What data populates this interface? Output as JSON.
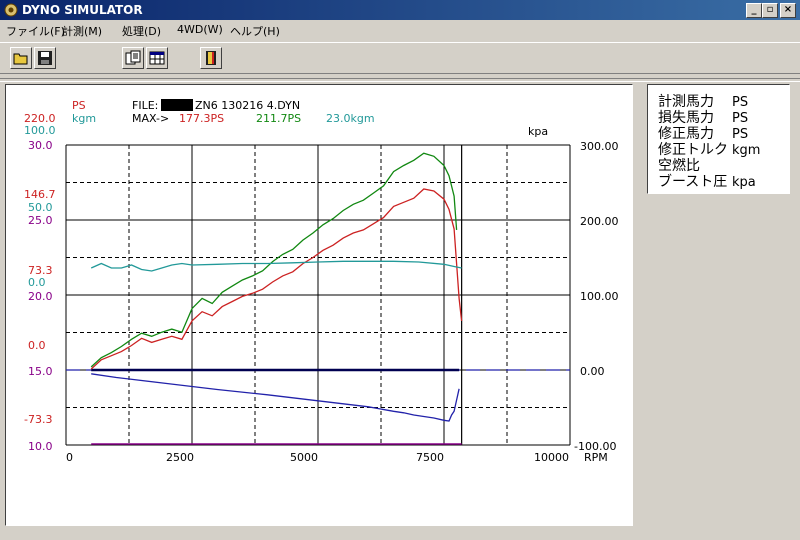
{
  "window": {
    "title": "DYNO SIMULATOR",
    "min_glyph": "_",
    "max_glyph": "▫",
    "close_glyph": "×"
  },
  "menu": [
    {
      "label": "ファイル(F)"
    },
    {
      "label": "計測(M)"
    },
    {
      "label": "処理(D)"
    },
    {
      "label": "4WD(W)"
    },
    {
      "label": "ヘルプ(H)"
    }
  ],
  "toolbar": {
    "buttons": [
      "open-folder-icon",
      "save-disk-icon",
      "process-icon",
      "table-icon",
      "exit-door-icon"
    ]
  },
  "header": {
    "ps_label": "PS",
    "kgm_label": "kgm",
    "file_prefix": "FILE:",
    "file_name": "ZN6  130216  4.DYN",
    "max_label": "MAX->",
    "max_ps": "177.3PS",
    "max_ps2": "211.7PS",
    "max_kgm": "23.0kgm",
    "right_unit": "kpa",
    "x_unit": "RPM"
  },
  "legend": [
    {
      "name": "計測馬力",
      "unit": "PS"
    },
    {
      "name": "損失馬力",
      "unit": "PS"
    },
    {
      "name": "修正馬力",
      "unit": "PS"
    },
    {
      "name": "修正トルク",
      "unit": "kgm"
    },
    {
      "name": "空燃比",
      "unit": ""
    },
    {
      "name": "ブースト圧",
      "unit": "kpa"
    }
  ],
  "colors": {
    "ps": "#cc2222",
    "kgm": "#229999",
    "afr": "#880088",
    "green": "#118811",
    "boost": "#2222aa",
    "dark": "#000000"
  },
  "chart_data": {
    "type": "line",
    "xlabel": "RPM",
    "xlim": [
      0,
      10000
    ],
    "x_ticks": [
      "0",
      "2500",
      "5000",
      "7500",
      "10000"
    ],
    "left_ticks_ps": [
      "220.0",
      "146.7",
      "73.3",
      "0.0",
      "-73.3"
    ],
    "left_ticks_kgm": [
      "100.0",
      "50.0",
      "0.0"
    ],
    "left_ticks_afr": [
      "30.0",
      "25.0",
      "20.0",
      "15.0",
      "10.0"
    ],
    "right_ticks_kpa": [
      "300.00",
      "200.00",
      "100.00",
      "0.00",
      "-100.00"
    ],
    "ylim_ps": [
      -110,
      220
    ],
    "ylim_kpa": [
      -100,
      300
    ],
    "series": [
      {
        "name": "修正馬力",
        "axis": "ps",
        "x": [
          500,
          700,
          900,
          1100,
          1300,
          1500,
          1700,
          1900,
          2100,
          2300,
          2500,
          2700,
          2900,
          3100,
          3300,
          3500,
          3700,
          3900,
          4100,
          4300,
          4500,
          4700,
          4900,
          5100,
          5300,
          5500,
          5700,
          5900,
          6100,
          6300,
          6500,
          6700,
          6900,
          7100,
          7300,
          7500,
          7600,
          7700,
          7800,
          7850
        ],
        "y": [
          1,
          10,
          14,
          18,
          24,
          31,
          27,
          30,
          33,
          30,
          48,
          57,
          53,
          62,
          67,
          72,
          75,
          79,
          86,
          92,
          96,
          104,
          110,
          117,
          122,
          129,
          134,
          137,
          143,
          149,
          160,
          164,
          168,
          177,
          175,
          167,
          157,
          138,
          70,
          48
        ]
      },
      {
        "name": "計測馬力",
        "axis": "ps",
        "x": [
          500,
          700,
          900,
          1100,
          1300,
          1500,
          1700,
          1900,
          2100,
          2300,
          2500,
          2700,
          2900,
          3100,
          3300,
          3500,
          3700,
          3900,
          4100,
          4300,
          4500,
          4700,
          4900,
          5100,
          5300,
          5500,
          5700,
          5900,
          6100,
          6300,
          6500,
          6700,
          6900,
          7100,
          7300,
          7500,
          7600,
          7700,
          7750
        ],
        "y": [
          3,
          12,
          17,
          23,
          30,
          36,
          33,
          37,
          40,
          37,
          60,
          70,
          65,
          76,
          82,
          88,
          92,
          97,
          106,
          113,
          118,
          127,
          134,
          142,
          148,
          156,
          162,
          166,
          173,
          180,
          194,
          200,
          205,
          212,
          209,
          200,
          190,
          170,
          137
        ]
      },
      {
        "name": "修正トルク",
        "axis": "kgm",
        "x": [
          500,
          700,
          900,
          1100,
          1300,
          1500,
          1700,
          1900,
          2100,
          2300,
          2500,
          3000,
          3500,
          4000,
          4500,
          5000,
          5500,
          6000,
          6500,
          7000,
          7500,
          7700,
          7850
        ],
        "y": [
          18,
          21,
          18,
          18,
          20,
          17,
          16,
          18,
          20,
          21,
          20,
          20.5,
          21,
          21,
          21.5,
          22,
          22.5,
          22.5,
          22.5,
          22,
          20.5,
          19,
          18
        ]
      },
      {
        "name": "ブースト圧",
        "axis": "kpa",
        "x": [
          500,
          1000,
          2000,
          3000,
          4000,
          5000,
          6000,
          6500,
          6700,
          6900,
          7100,
          7300,
          7500,
          7600,
          7650,
          7700,
          7750,
          7800
        ],
        "y": [
          -5,
          -10,
          -18,
          -26,
          -33,
          -41,
          -49,
          -55,
          -57,
          -60,
          -62,
          -64,
          -67,
          -68,
          -60,
          -55,
          -40,
          -25
        ]
      }
    ]
  }
}
